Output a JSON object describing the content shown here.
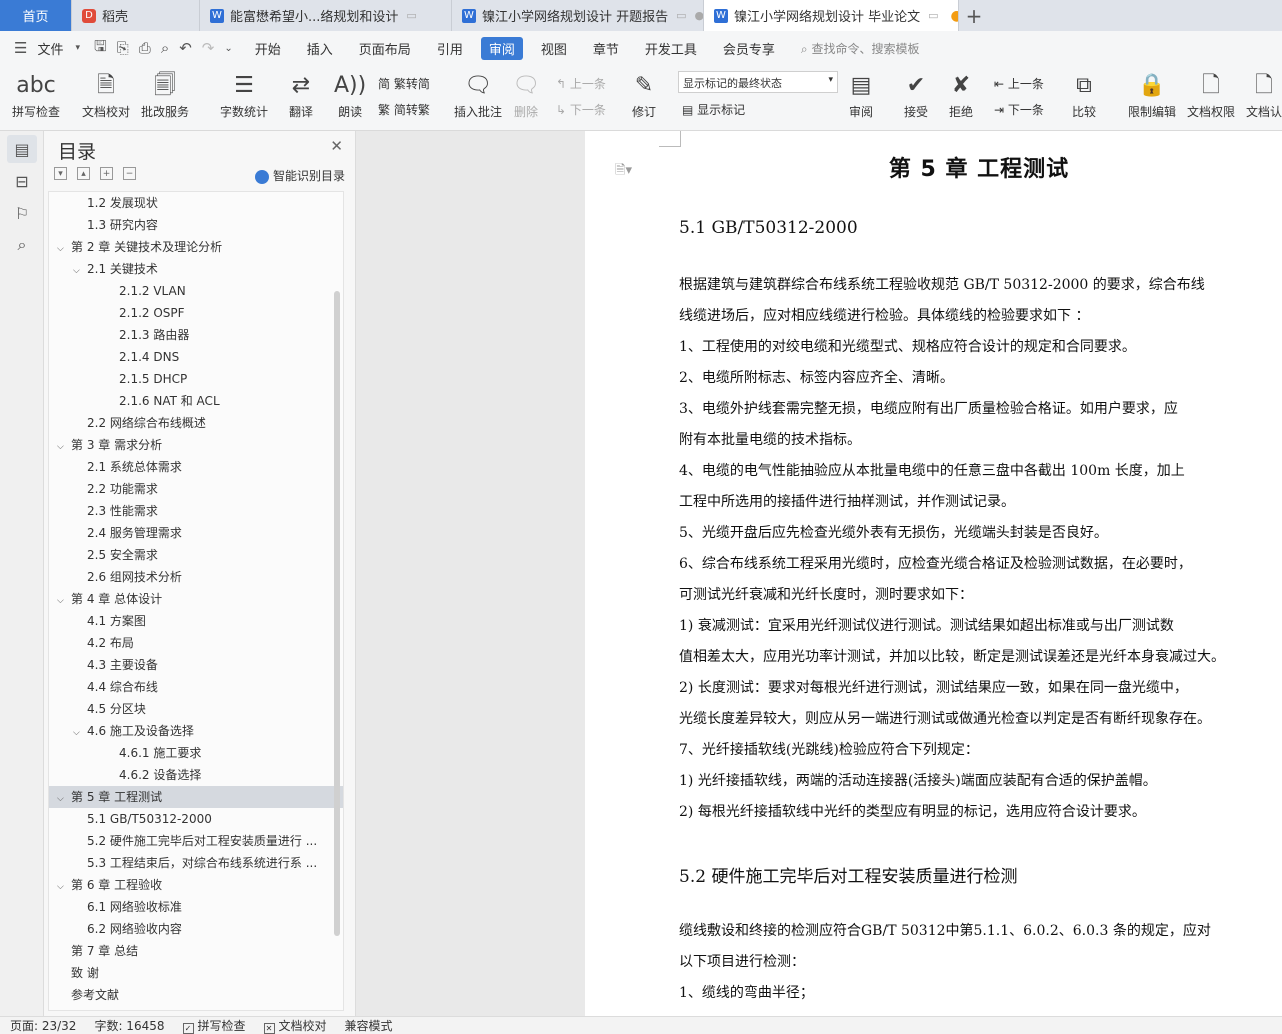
{
  "tabs": [
    {
      "label": "首页"
    },
    {
      "label": "稻壳"
    },
    {
      "label": "能富懋希望小...络规划和设计"
    },
    {
      "label": "镍江小学网络规划设计 开题报告"
    },
    {
      "label": "镍江小学网络规划设计 毕业论文"
    }
  ],
  "menu": {
    "file": "文件",
    "items": [
      "开始",
      "插入",
      "页面布局",
      "引用",
      "审阅",
      "视图",
      "章节",
      "开发工具",
      "会员专享"
    ],
    "search": "查找命令、搜索模板"
  },
  "ribbon": {
    "spell": "拼写检查",
    "proof": "文档校对",
    "annotate_service": "批改服务",
    "wordcount": "字数统计",
    "translate": "翻译",
    "read": "朗读",
    "trad": "繁转简",
    "simp": "简转繁",
    "insert_comment": "插入批注",
    "delete": "删除",
    "prev_small": "上一条",
    "next_small": "下一条",
    "revise": "修订",
    "track_state": "显示标记的最终状态",
    "show_marks": "显示标记",
    "review": "审阅",
    "accept": "接受",
    "reject": "拒绝",
    "prev": "上一条",
    "next": "下一条",
    "compare": "比较",
    "restrict": "限制编辑",
    "doc_perm": "文档权限",
    "doc_auth": "文档认"
  },
  "toc": {
    "title": "目录",
    "smart": "智能识别目录",
    "items": [
      {
        "label": "1.2  发展现状",
        "level": 2
      },
      {
        "label": "1.3  研究内容",
        "level": 2
      },
      {
        "label": "第 2 章  关键技术及理论分析",
        "level": 1,
        "chev": "v"
      },
      {
        "label": "2.1  关键技术",
        "level": 2,
        "chev": "v"
      },
      {
        "label": "2.1.2 VLAN",
        "level": 3
      },
      {
        "label": "2.1.2 OSPF",
        "level": 3
      },
      {
        "label": "2.1.3  路由器",
        "level": 3
      },
      {
        "label": "2.1.4 DNS",
        "level": 3
      },
      {
        "label": "2.1.5 DHCP",
        "level": 3
      },
      {
        "label": "2.1.6 NAT 和 ACL",
        "level": 3
      },
      {
        "label": "2.2  网络综合布线概述",
        "level": 2
      },
      {
        "label": "第 3 章  需求分析",
        "level": 1,
        "chev": "v"
      },
      {
        "label": "2.1  系统总体需求",
        "level": 2
      },
      {
        "label": "2.2  功能需求",
        "level": 2
      },
      {
        "label": "2.3  性能需求",
        "level": 2
      },
      {
        "label": "2.4  服务管理需求",
        "level": 2
      },
      {
        "label": "2.5  安全需求",
        "level": 2
      },
      {
        "label": "2.6  组网技术分析",
        "level": 2
      },
      {
        "label": "第 4 章  总体设计",
        "level": 1,
        "chev": "v"
      },
      {
        "label": "4.1  方案图",
        "level": 2
      },
      {
        "label": "4.2  布局",
        "level": 2
      },
      {
        "label": "4.3  主要设备",
        "level": 2
      },
      {
        "label": "4.4  综合布线",
        "level": 2
      },
      {
        "label": "4.5  分区块",
        "level": 2
      },
      {
        "label": "4.6  施工及设备选择",
        "level": 2,
        "chev": "v"
      },
      {
        "label": "4.6.1  施工要求",
        "level": 3
      },
      {
        "label": "4.6.2  设备选择",
        "level": 3
      },
      {
        "label": "第 5 章  工程测试",
        "level": 1,
        "chev": "v",
        "selected": true
      },
      {
        "label": "5.1 GB/T50312-2000",
        "level": 2
      },
      {
        "label": "5.2  硬件施工完毕后对工程安装质量进行 ...",
        "level": 2
      },
      {
        "label": "5.3  工程结束后，对综合布线系统进行系 ...",
        "level": 2
      },
      {
        "label": "第 6 章  工程验收",
        "level": 1,
        "chev": "v"
      },
      {
        "label": "6.1  网络验收标准",
        "level": 2
      },
      {
        "label": "6.2  网络验收内容",
        "level": 2
      },
      {
        "label": "第 7 章  总结",
        "level": 1
      },
      {
        "label": "致    谢",
        "level": 1
      },
      {
        "label": "参考文献",
        "level": 1
      }
    ]
  },
  "doc": {
    "chapter": "第 5 章  工程测试",
    "s51": "5.1 GB/T50312-2000",
    "lines": [
      "        根据建筑与建筑群综合布线系统工程验收规范 GB/T 50312-2000 的要求，综合布线",
      "线缆进场后，应对相应线缆进行检验。具体缆线的检验要求如下 ：",
      "        1、工程使用的对绞电缆和光缆型式、规格应符合设计的规定和合同要求。",
      "        2、电缆所附标志、标签内容应齐全、清晰。",
      "        3、电缆外护线套需完整无损，电缆应附有出厂质量检验合格证。如用户要求，应",
      "附有本批量电缆的技术指标。",
      "        4、电缆的电气性能抽验应从本批量电缆中的任意三盘中各截出 100m 长度，加上",
      "工程中所选用的接插件进行抽样测试，并作测试记录。",
      "        5、光缆开盘后应先检查光缆外表有无损伤，光缆端头封装是否良好。",
      "        6、综合布线系统工程采用光缆时，应检查光缆合格证及检验测试数据，在必要时，",
      "可测试光纤衰减和光纤长度时，测时要求如下：",
      "        1) 衰减测试：宜采用光纤测试仪进行测试。测试结果如超出标准或与出厂测试数",
      "值相差太大，应用光功率计测试，并加以比较，断定是测试误差还是光纤本身衰减过大。",
      "        2) 长度测试：要求对每根光纤进行测试，测试结果应一致，如果在同一盘光缆中，",
      "光缆长度差异较大，则应从另一端进行测试或做通光检查以判定是否有断纤现象存在。",
      "        7、光纤接插软线(光跳线)检验应符合下列规定：",
      "        1) 光纤接插软线，两端的活动连接器(活接头)端面应装配有合适的保护盖帽。",
      "        2) 每根光纤接插软线中光纤的类型应有明显的标记，选用应符合设计要求。"
    ],
    "s52": "5.2  硬件施工完毕后对工程安装质量进行检测",
    "lines2": [
      "        缆线敷设和终接的检测应符合GB/T 50312中第5.1.1、6.0.2、6.0.3  条的规定，应对",
      "以下项目进行检测：",
      "        1、缆线的弯曲半径；"
    ]
  },
  "status": {
    "page": "页面: 23/32",
    "words": "字数: 16458",
    "spell": "拼写检查",
    "proof": "文档校对",
    "compat": "兼容模式"
  }
}
